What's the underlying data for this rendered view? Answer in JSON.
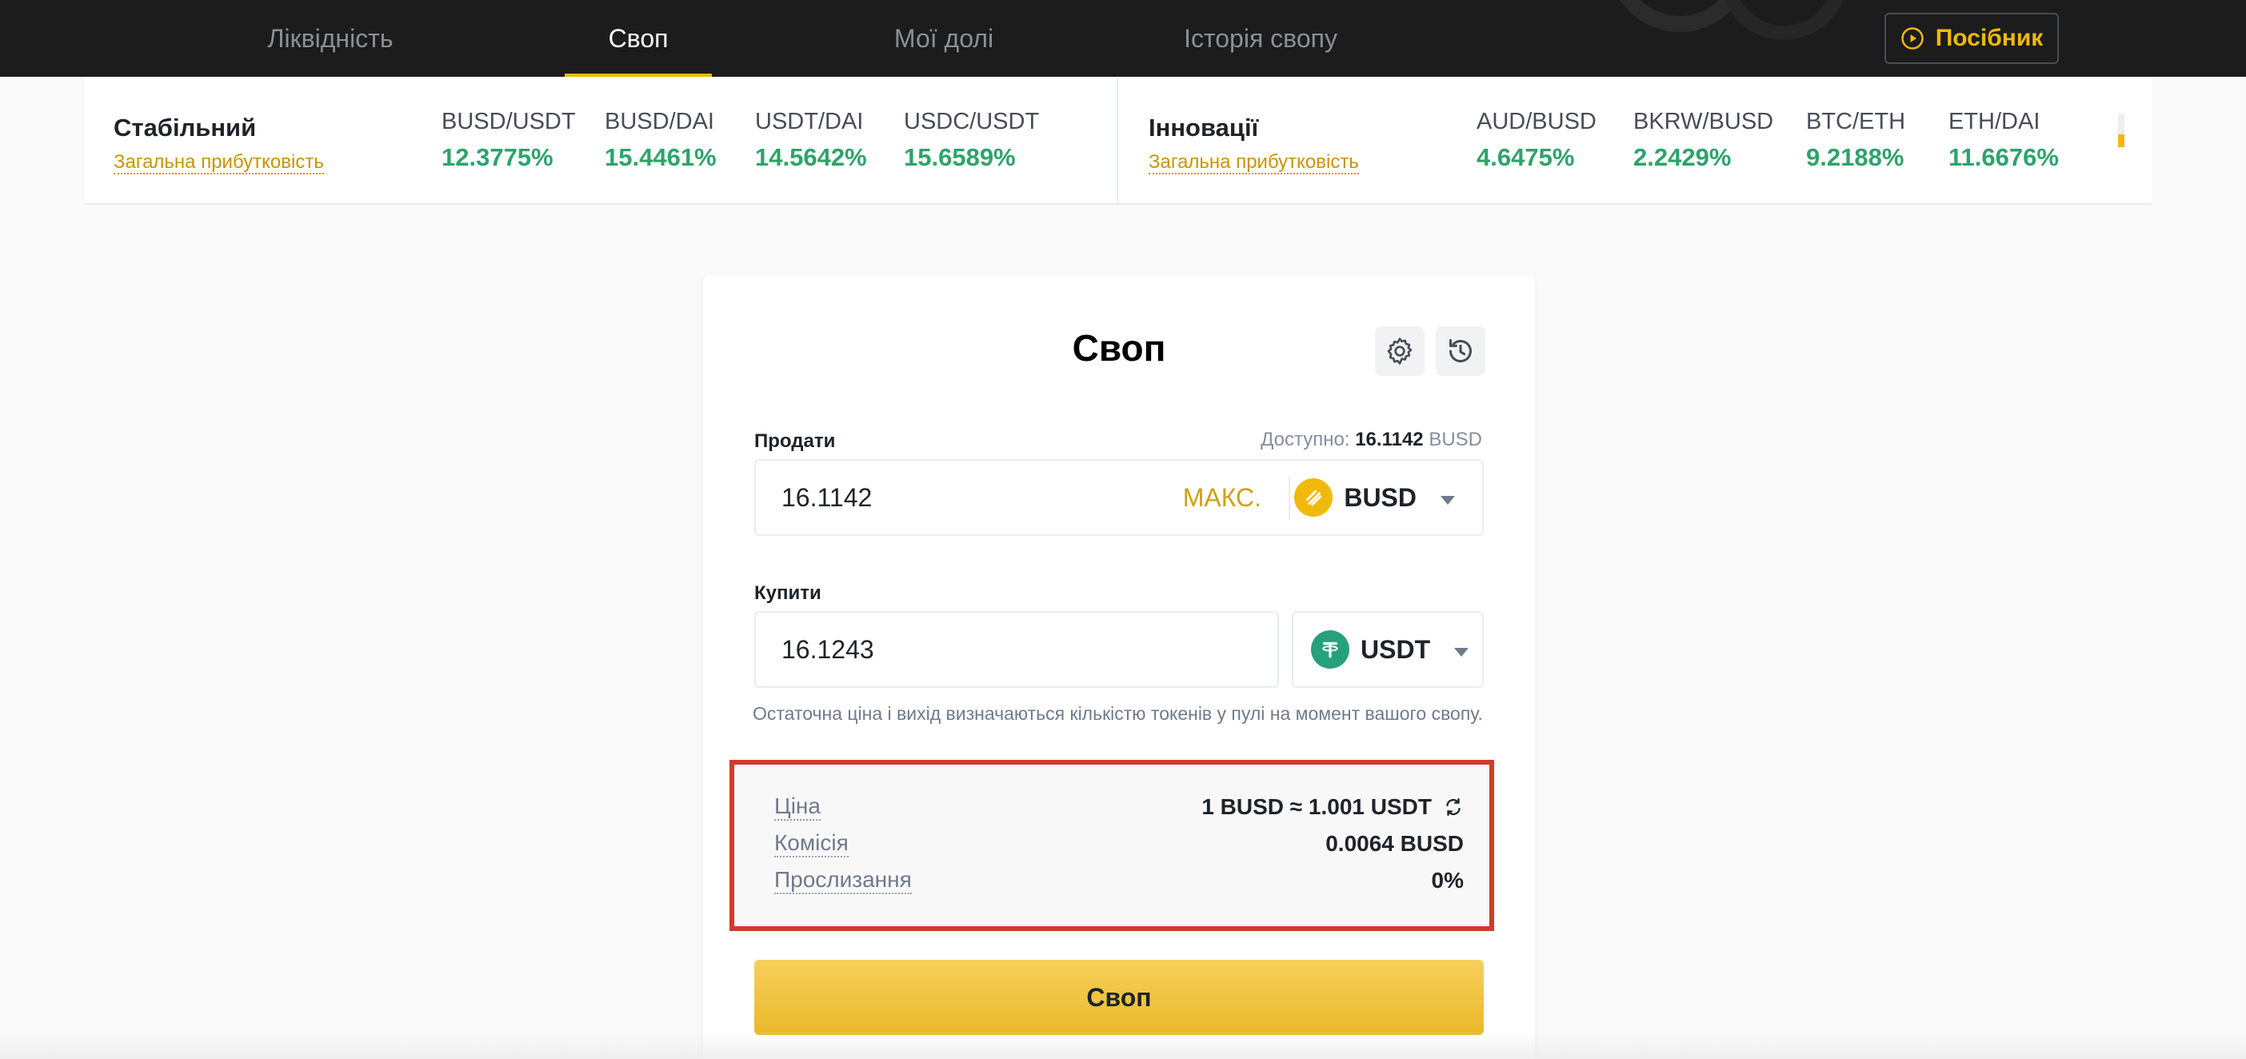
{
  "nav": {
    "tabs": [
      {
        "label": "Ліквідність"
      },
      {
        "label": "Своп"
      },
      {
        "label": "Мої долі"
      },
      {
        "label": "Історія свопу"
      }
    ],
    "guide_label": "Посібник"
  },
  "yields": {
    "stable": {
      "title": "Стабільний",
      "link": "Загальна прибутковість",
      "pairs": [
        {
          "name": "BUSD/USDT",
          "value": "12.3775%"
        },
        {
          "name": "BUSD/DAI",
          "value": "15.4461%"
        },
        {
          "name": "USDT/DAI",
          "value": "14.5642%"
        },
        {
          "name": "USDC/USDT",
          "value": "15.6589%"
        }
      ]
    },
    "innovation": {
      "title": "Інновації",
      "link": "Загальна прибутковість",
      "pairs": [
        {
          "name": "AUD/BUSD",
          "value": "4.6475%"
        },
        {
          "name": "BKRW/BUSD",
          "value": "2.2429%"
        },
        {
          "name": "BTC/ETH",
          "value": "9.2188%"
        },
        {
          "name": "ETH/DAI",
          "value": "11.6676%"
        }
      ]
    }
  },
  "swap": {
    "title": "Своп",
    "sell_label": "Продати",
    "available_prefix": "Доступно:",
    "available_amount": "16.1142",
    "available_token": "BUSD",
    "sell_value": "16.1142",
    "max_label": "МАКС.",
    "sell_token": "BUSD",
    "buy_label": "Купити",
    "buy_value": "16.1243",
    "buy_token": "USDT",
    "note": "Остаточна ціна і вихід визначаються кількістю токенів у пулі на момент вашого свопу.",
    "info": {
      "price_label": "Ціна",
      "price_value": "1 BUSD ≈ 1.001 USDT",
      "fee_label": "Комісія",
      "fee_value": "0.0064 BUSD",
      "slippage_label": "Прослизання",
      "slippage_value": "0%"
    },
    "button_label": "Своп"
  },
  "colors": {
    "accent": "#f0b90b",
    "positive": "#2ea36a",
    "highlight_border": "#d23a2c",
    "busd": "#f0b90b",
    "usdt": "#26a17b"
  }
}
